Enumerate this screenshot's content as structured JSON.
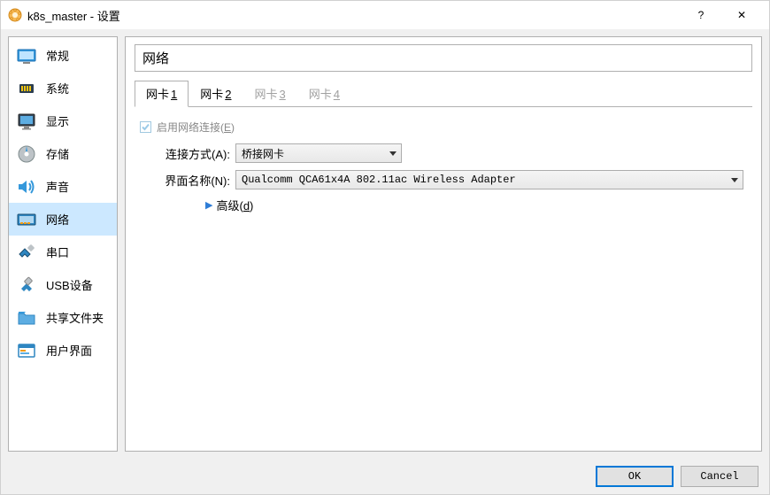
{
  "title": "k8s_master - 设置",
  "sidebar": {
    "items": [
      {
        "label": "常规",
        "icon": "general"
      },
      {
        "label": "系统",
        "icon": "system"
      },
      {
        "label": "显示",
        "icon": "display"
      },
      {
        "label": "存储",
        "icon": "storage"
      },
      {
        "label": "声音",
        "icon": "audio"
      },
      {
        "label": "网络",
        "icon": "network"
      },
      {
        "label": "串口",
        "icon": "serial"
      },
      {
        "label": "USB设备",
        "icon": "usb"
      },
      {
        "label": "共享文件夹",
        "icon": "shared"
      },
      {
        "label": "用户界面",
        "icon": "ui"
      }
    ],
    "active_index": 5
  },
  "main": {
    "heading": "网络",
    "tabs": [
      {
        "label": "网卡",
        "num": "1",
        "active": true,
        "disabled": false
      },
      {
        "label": "网卡",
        "num": "2",
        "active": false,
        "disabled": false
      },
      {
        "label": "网卡",
        "num": "3",
        "active": false,
        "disabled": true
      },
      {
        "label": "网卡",
        "num": "4",
        "active": false,
        "disabled": true
      }
    ],
    "enable_label": "启用网络连接(",
    "enable_key": "E",
    "enable_label_end": ")",
    "enable_checked": true,
    "enable_disabled": true,
    "attach_label": "连接方式(A):",
    "attach_value": "桥接网卡",
    "iface_label": "界面名称(N):",
    "iface_value": "Qualcomm QCA61x4A 802.11ac Wireless Adapter",
    "advanced_label": "高级(",
    "advanced_key": "d",
    "advanced_label_end": ")"
  },
  "buttons": {
    "ok": "OK",
    "cancel": "Cancel"
  },
  "help_symbol": "?",
  "close_symbol": "✕"
}
